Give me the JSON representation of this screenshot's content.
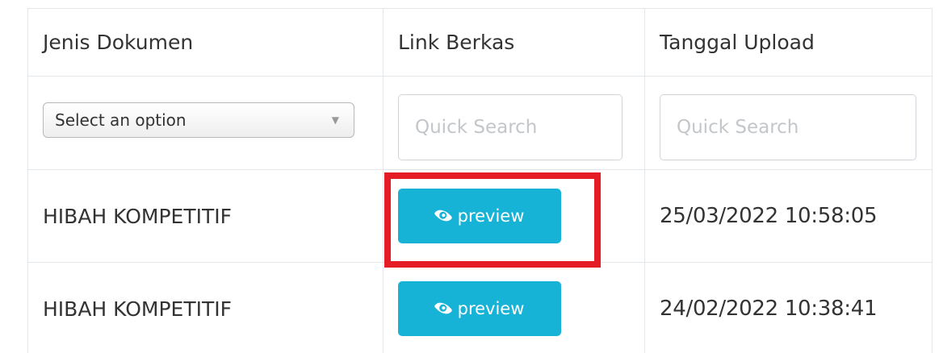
{
  "table": {
    "headers": [
      "Jenis Dokumen",
      "Link Berkas",
      "Tanggal Upload"
    ],
    "filters": {
      "jenis_select": "Select an option",
      "link_placeholder": "Quick Search",
      "tanggal_placeholder": "Quick Search"
    },
    "rows": [
      {
        "jenis": "HIBAH KOMPETITIF",
        "link_label": "preview",
        "tanggal": "25/03/2022 10:58:05"
      },
      {
        "jenis": "HIBAH KOMPETITIF",
        "link_label": "preview",
        "tanggal": "24/02/2022 10:38:41"
      }
    ]
  },
  "icons": {
    "preview": "eye-icon",
    "select_arrow": "triangle-down-icon"
  },
  "colors": {
    "button": "#17b3d6",
    "highlight": "#e31c25",
    "border": "#e4e7ea"
  }
}
